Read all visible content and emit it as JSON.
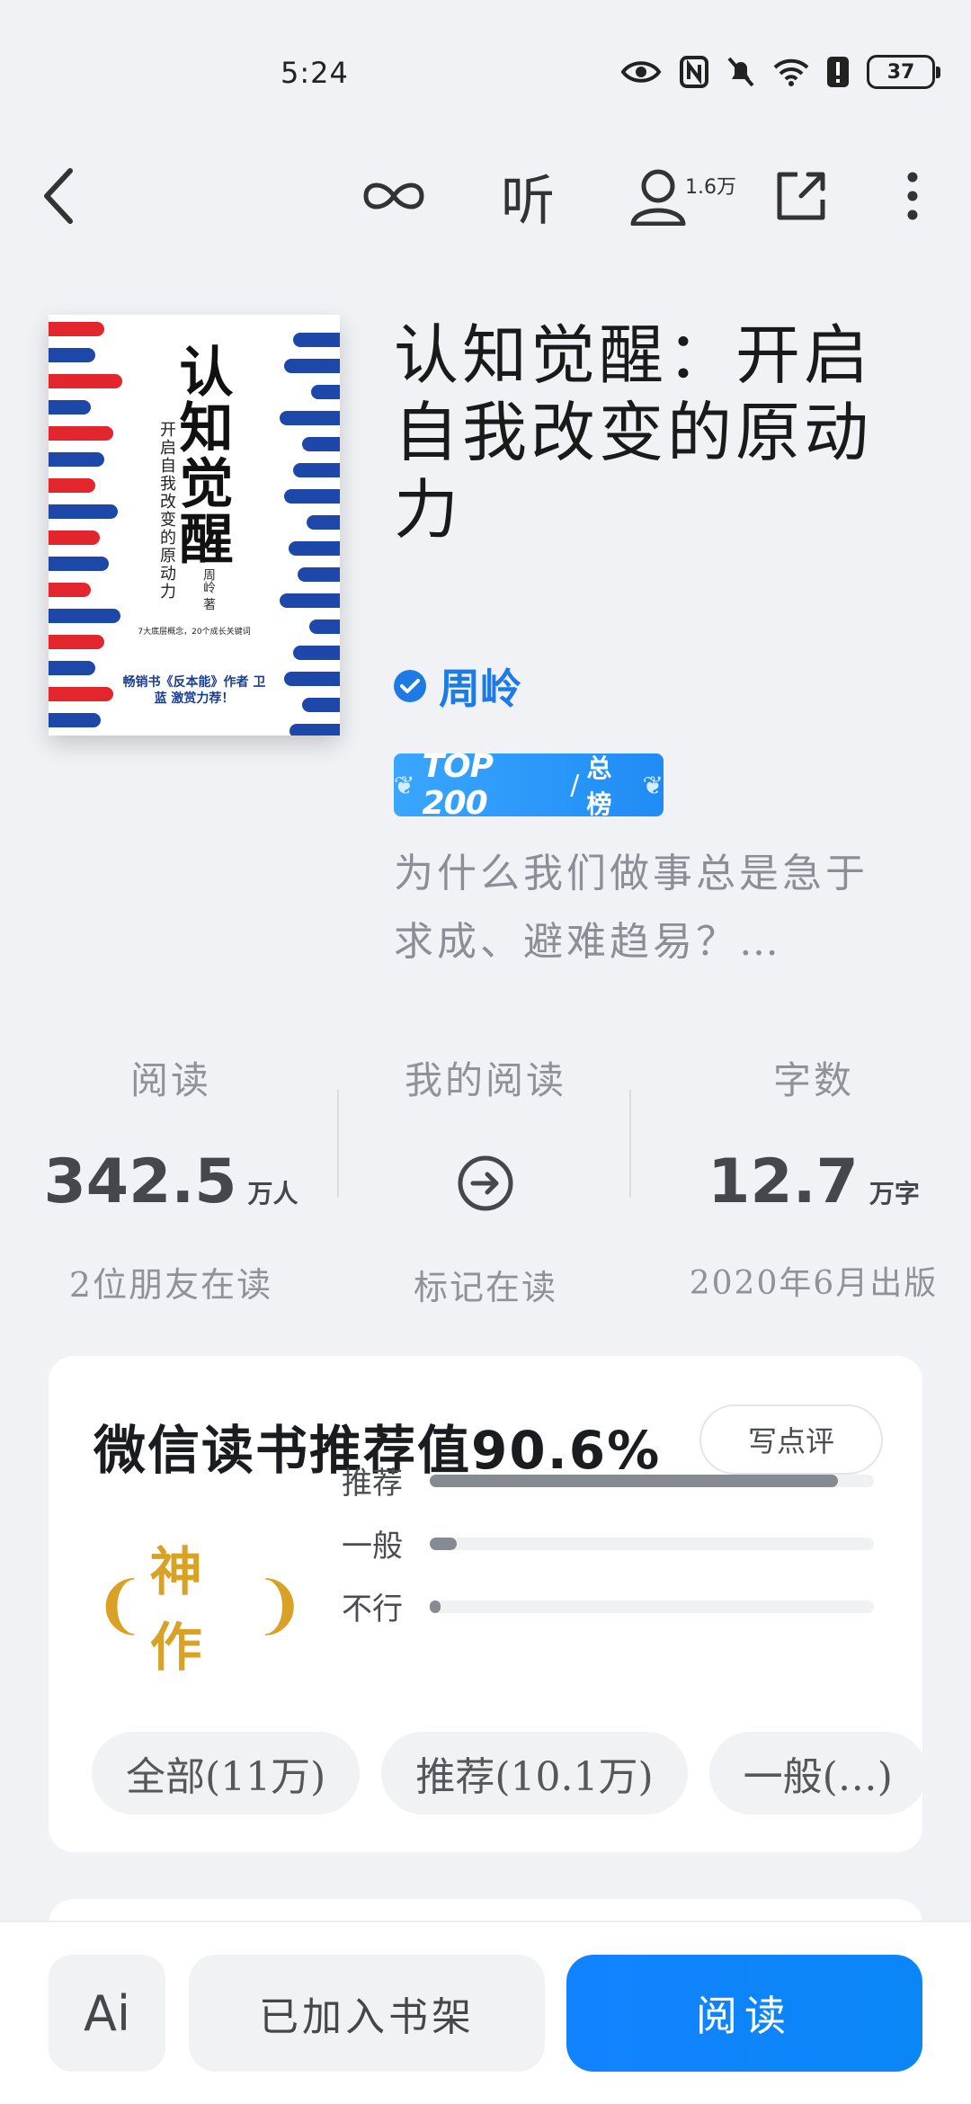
{
  "status_bar": {
    "time": "5:24",
    "battery": "37"
  },
  "nav": {
    "listen_label": "听",
    "readers_count": "1.6万"
  },
  "cover": {
    "title": "认知觉醒",
    "subtitle": "开启自我改变的原动力",
    "author": "周岭 著",
    "blurb": "7大底层概念，20个成长关键词",
    "quote": "畅销书《反本能》作者 卫蓝 激赏力荐！"
  },
  "book": {
    "title": "认知觉醒：开启自我改变的原动力",
    "author": "周岭",
    "rank_top": "TOP 200",
    "rank_board": "总榜",
    "intro": "为什么我们做事总是急于求成、避难趋易？…"
  },
  "stats": {
    "reads": {
      "label": "阅读",
      "value": "342.5",
      "unit": "万人",
      "sub": "2位朋友在读"
    },
    "my_reading": {
      "label": "我的阅读",
      "sub": "标记在读"
    },
    "words": {
      "label": "字数",
      "value": "12.7",
      "unit": "万字",
      "sub": "2020年6月出版"
    }
  },
  "recommend": {
    "title": "微信读书推荐值",
    "value": "90.6%",
    "review_button": "写点评",
    "badge": "神作",
    "bars": [
      {
        "label": "推荐",
        "fraction": 0.92
      },
      {
        "label": "一般",
        "fraction": 0.06
      },
      {
        "label": "不行",
        "fraction": 0.02
      }
    ],
    "filters": [
      "全部(11万)",
      "推荐(10.1万)",
      "一般(…)"
    ]
  },
  "bottom": {
    "ai_label": "Ai",
    "shelf_label": "已加入书架",
    "read_label": "阅读"
  },
  "colors": {
    "accent": "#1283ff",
    "gold": "#d9a224",
    "bar": "#868a91"
  }
}
